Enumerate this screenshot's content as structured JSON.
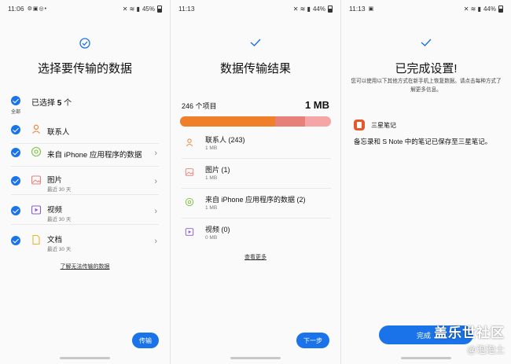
{
  "screen1": {
    "status": {
      "time": "11:06",
      "battery": "45%"
    },
    "title": "选择要传输的数据",
    "select_all": {
      "prefix": "已选择 ",
      "count": "5",
      "suffix": " 个",
      "sub": "全部"
    },
    "items": [
      {
        "label": "联系人",
        "sub": "",
        "icon": "contacts-icon"
      },
      {
        "label": "来自 iPhone 应用程序的数据",
        "sub": "",
        "icon": "app-data-icon"
      },
      {
        "label": "图片",
        "sub": "最近 30 天",
        "icon": "image-icon"
      },
      {
        "label": "视频",
        "sub": "最近 30 天",
        "icon": "video-icon"
      },
      {
        "label": "文档",
        "sub": "最近 30 天",
        "icon": "document-icon"
      }
    ],
    "link": "了解无法传输的数据",
    "button": "传输"
  },
  "screen2": {
    "status": {
      "time": "11:13",
      "battery": "44%"
    },
    "title": "数据传输结果",
    "summary": {
      "count": "246 个项目",
      "size": "1 MB"
    },
    "progress_fractions": [
      0.63,
      0.2,
      0.17
    ],
    "items": [
      {
        "label": "联系人 (243)",
        "sub": "1 MB",
        "icon": "contacts-icon"
      },
      {
        "label": "图片 (1)",
        "sub": "1 MB",
        "icon": "image-icon"
      },
      {
        "label": "来自 iPhone 应用程序的数据 (2)",
        "sub": "1 MB",
        "icon": "app-data-icon"
      },
      {
        "label": "视频 (0)",
        "sub": "0 MB",
        "icon": "video-icon"
      }
    ],
    "link": "查看更多",
    "button": "下一步"
  },
  "screen3": {
    "status": {
      "time": "11:13",
      "battery": "44%"
    },
    "title": "已完成设置!",
    "description": "您可以使用以下其他方式在新手机上恢复数据。请点击每种方式了解更多信息。",
    "app": {
      "name": "三星笔记",
      "icon": "samsung-notes-icon"
    },
    "note": "备忘录和 S Note 中的笔记已保存至三星笔记。",
    "button": "完成"
  },
  "watermark": {
    "line1": "盖乐世社区",
    "line2": "@泡泡土"
  },
  "colors": {
    "accent": "#1a73e8",
    "bar_orange": "#f07f2a",
    "bar_red": "#e8807a",
    "bar_pink": "#f5a5a5",
    "notes_orange": "#e4582b"
  }
}
